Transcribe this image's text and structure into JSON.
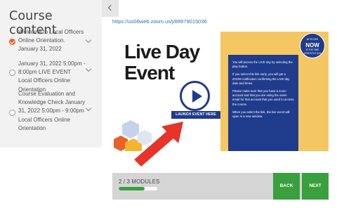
{
  "sidebar": {
    "title": "Course content",
    "items": [
      {
        "label": "Welcome to Local Officers Online Orientation. January 31, 2022",
        "status": "completed"
      },
      {
        "label": "January 31, 2022 5:00pm - 8:00pm LIVE EVENT Local Officers Online Orientation",
        "status": "not-started"
      },
      {
        "label": "Course Evaluation and Knowledge Check January 31, 2022 5:00pm - 9:00pm Local Officers Online Orientation",
        "status": "not-started"
      }
    ]
  },
  "meeting_link": "https://us06web.zoom.us/j/88979015036",
  "event": {
    "title_line1": "Live Day",
    "title_line2": "Event",
    "launch_label": "LAUNCH EVENT HERE",
    "badge": {
      "top": "AFSCME",
      "main": "NOW",
      "sub": "IS THE TIME",
      "bottom": "ORIENTATION"
    },
    "instructions": [
      "You will access the LIVE day by selecting the play button.",
      "If you select this link early, you will get a ZOOM notification confirming the LIVE day date and times.",
      "Please make sure that you have a zoom account and that you are using the same email for that account that you used to access the course.",
      "When you select the link, the live event will open in a new window."
    ]
  },
  "progress": {
    "label": "2 / 3 MODULES",
    "fraction": 0.6667
  },
  "buttons": {
    "back": "BACK",
    "next": "NEXT"
  },
  "colors": {
    "accent_green": "#3aa03e",
    "navy": "#1f3b8c",
    "yellow": "#f5c763",
    "arrow_red": "#e8332a",
    "status_orange": "#e8612c"
  }
}
